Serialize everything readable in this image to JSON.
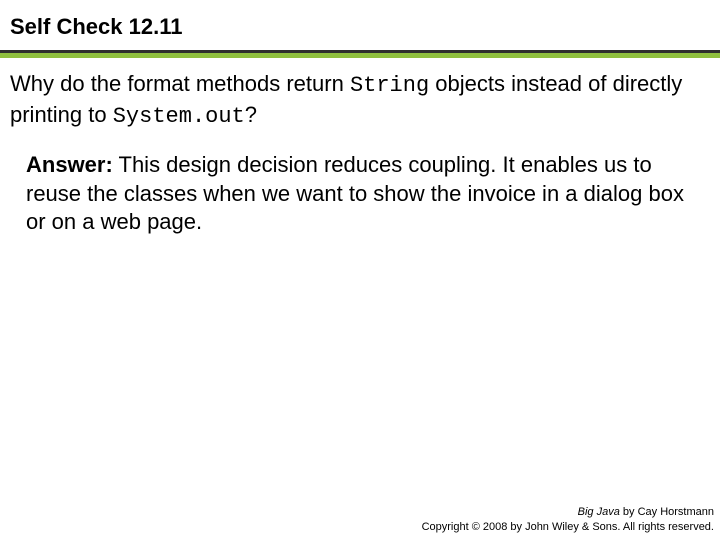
{
  "title": "Self Check 12.11",
  "question": {
    "pre": "Why do the format methods return ",
    "code1": "String",
    "mid": " objects instead of directly printing to ",
    "code2": "System.out",
    "post": "?"
  },
  "answer": {
    "label": "Answer:",
    "text": " This design decision reduces coupling. It enables us to reuse the classes when we want to show the invoice in a dialog box or on a web page."
  },
  "footer": {
    "book": "Big Java",
    "author": " by Cay Horstmann",
    "copyright": "Copyright © 2008 by John Wiley & Sons.  All rights reserved."
  }
}
